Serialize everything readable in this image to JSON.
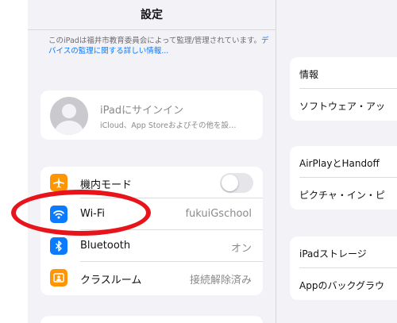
{
  "colors": {
    "pane_bg": "#f2f2f7",
    "card_bg": "#ffffff",
    "link": "#0a7aff",
    "annotation": "#e8141b",
    "airplane_icon": "#ff9500",
    "wifi_icon": "#0a7aff",
    "bluetooth_icon": "#0a7aff",
    "classroom_icon": "#ff9500"
  },
  "nav": {
    "title": "設定"
  },
  "supervision": {
    "text": "このiPadは福井市教育委員会によって監理/管理されています。",
    "link": "デバイスの監理に関する詳しい情報..."
  },
  "signin": {
    "title": "iPadにサインイン",
    "subtitle": "iCloud、App Storeおよびその他を設…"
  },
  "settings": {
    "airplane": {
      "icon": "airplane-icon",
      "label": "機内モード",
      "toggle_on": false
    },
    "wifi": {
      "icon": "wifi-icon",
      "label": "Wi-Fi",
      "value": "fukuiGschool"
    },
    "bluetooth": {
      "icon": "bluetooth-icon",
      "label": "Bluetooth",
      "value": "オン"
    },
    "classroom": {
      "icon": "classroom-icon",
      "label": "クラスルーム",
      "value": "接続解除済み"
    }
  },
  "detail": {
    "group1": [
      "情報",
      "ソフトウェア・アッ"
    ],
    "group2": [
      "AirPlayとHandoff",
      "ピクチャ・イン・ピ"
    ],
    "group3": [
      "iPadストレージ",
      "Appのバックグラウ"
    ]
  }
}
